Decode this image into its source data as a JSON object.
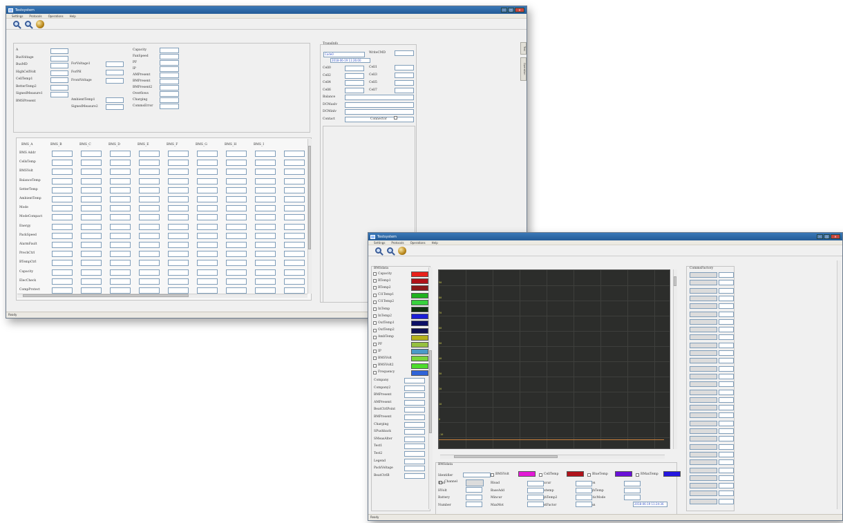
{
  "window1": {
    "title": "Testsystem",
    "menu": [
      "Settings",
      "Protocols",
      "Operations",
      "Help"
    ],
    "status": "Ready",
    "side_tabs": [
      "Test",
      "Operation"
    ],
    "left_labels": [
      "A",
      "BusVoltage",
      "BusMD",
      "HighCellVolt",
      "CellTemp1",
      "BetterTemp2",
      "SignedMeasure1",
      "BMSPresent"
    ],
    "mid_labels": [
      "ForVoltage1",
      "ForPH",
      "FrontVoltage",
      "AmbientTemp1",
      "SignedMeasure2"
    ],
    "right_labels": [
      "Capacity",
      "FanSpeed",
      "PF",
      "IP",
      "AMPresent",
      "BMPresent",
      "BMPresent2",
      "Overflows",
      "Charging",
      "CommsError"
    ],
    "rp_title": "TransInfo",
    "rp_first_value": "Code0",
    "rp_datetime": "2018-06-19 11:26:00",
    "rp_labels": [
      "Cell0",
      "Cell2",
      "Cell4",
      "Cell6",
      "Balance",
      "DCMaxlv",
      "DCMinlv",
      "Contact"
    ],
    "rp_labels_right": [
      "WriteCMD",
      "Cell1",
      "Cell3",
      "Cell5",
      "Cell7"
    ],
    "rp_connector_label": "Connector",
    "grid_cols": [
      "BMS_A",
      "BMS_B",
      "BMS_C",
      "BMS_D",
      "BMS_E",
      "BMS_F",
      "BMS_G",
      "BMS_H",
      "BMS_I"
    ],
    "grid_rows": [
      "BMS Addr",
      "CellsTemp",
      "BMSVolt",
      "BalanceTemp",
      "SetterTemp",
      "AmbientTemp",
      "Mode",
      "ModeCompact",
      "Energy",
      "PackSpeed",
      "AlarmFault",
      "PrechCtrl",
      "BTempCtrl",
      "Capacity",
      "ElecCheck",
      "CompProtect"
    ]
  },
  "window2": {
    "title": "Testsystem",
    "menu": [
      "Settings",
      "Protocols",
      "Operations",
      "Help"
    ],
    "status": "Ready",
    "list_header": "BMSdata",
    "checklist": [
      {
        "label": "Capacity",
        "color": "#e8211b"
      },
      {
        "label": "RTemp1",
        "color": "#b01218"
      },
      {
        "label": "RTemp2",
        "color": "#8a1a1a"
      },
      {
        "label": "Cl1Temp1",
        "color": "#1fb11f"
      },
      {
        "label": "Cl1Temp2",
        "color": "#37d23d"
      },
      {
        "label": "InTemp",
        "color": "#0f2f12"
      },
      {
        "label": "InTemp2",
        "color": "#1b1fd6"
      },
      {
        "label": "OutTemp1",
        "color": "#0d1066"
      },
      {
        "label": "OutTemp2",
        "color": "#101154"
      },
      {
        "label": "AmbTemp",
        "color": "#b5b21c"
      },
      {
        "label": "PF",
        "color": "#95c040"
      },
      {
        "label": "IP",
        "color": "#4a9ac8"
      },
      {
        "label": "BMSVolt",
        "color": "#79d43b"
      },
      {
        "label": "BMSVolt2",
        "color": "#4cdc2c"
      },
      {
        "label": "Frequency",
        "color": "#2f64d8"
      }
    ],
    "list_fields": [
      "Company",
      "Company2",
      "BMPresent",
      "AMPresent",
      "BeatCtrlPoint",
      "BMPresent",
      "Charging",
      "SPushback",
      "SMeasAlter",
      "Test1",
      "Test2",
      "Legend",
      "PackVoltage",
      "BeatCtrlB"
    ],
    "chart_ticks": [
      "90",
      "80",
      "70",
      "60",
      "50",
      "40",
      "30",
      "20",
      "10",
      "0",
      "-10"
    ],
    "bottom_title": "BMSdata",
    "bottom_series": [
      {
        "label": "BMSVolt",
        "color": "#e31ad6"
      },
      {
        "label": "CellTemp",
        "color": "#b0131b"
      },
      {
        "label": "BlueTemp",
        "color": "#6a11d8"
      },
      {
        "label": "RMaxTemp",
        "color": "#2416e0"
      }
    ],
    "bottom_row1": [
      "Identifier",
      "Channel"
    ],
    "bottom_labels": [
      "IFan",
      "Rload",
      "Maxcur",
      "Rcon",
      "HVolt",
      "BaseAdd",
      "Maxtemp",
      "HighTemp",
      "Battery",
      "Mincur",
      "HighTemp2",
      "StaticMode",
      "Number",
      "MaxMot",
      "HostFactor",
      "Span"
    ],
    "bottom_datetime": "2018-06-19 11:24:36",
    "right_title": "CommsFactory"
  }
}
